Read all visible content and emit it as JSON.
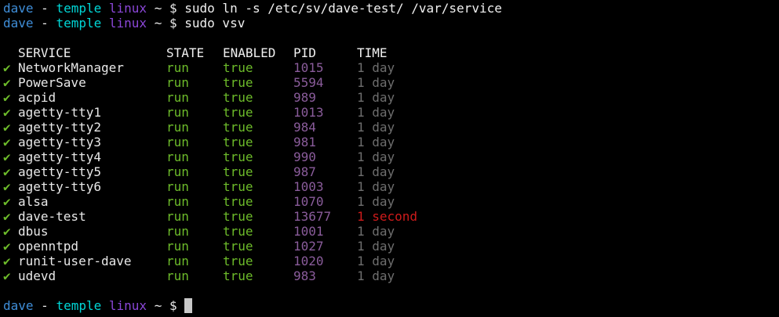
{
  "prompt": {
    "user": "dave",
    "dash": "-",
    "host": "temple",
    "os": "linux",
    "tilde": "~",
    "symbol": "$"
  },
  "commands": [
    "sudo ln -s /etc/sv/dave-test/ /var/service",
    "sudo vsv"
  ],
  "table": {
    "headers": {
      "service": "SERVICE",
      "state": "STATE",
      "enabled": "ENABLED",
      "pid": "PID",
      "time": "TIME"
    },
    "check_glyph": "✔",
    "rows": [
      {
        "service": "NetworkManager",
        "state": "run",
        "enabled": "true",
        "pid": "1015",
        "time": "1 day",
        "recent": false
      },
      {
        "service": "PowerSave",
        "state": "run",
        "enabled": "true",
        "pid": "5594",
        "time": "1 day",
        "recent": false
      },
      {
        "service": "acpid",
        "state": "run",
        "enabled": "true",
        "pid": "989",
        "time": "1 day",
        "recent": false
      },
      {
        "service": "agetty-tty1",
        "state": "run",
        "enabled": "true",
        "pid": "1013",
        "time": "1 day",
        "recent": false
      },
      {
        "service": "agetty-tty2",
        "state": "run",
        "enabled": "true",
        "pid": "984",
        "time": "1 day",
        "recent": false
      },
      {
        "service": "agetty-tty3",
        "state": "run",
        "enabled": "true",
        "pid": "981",
        "time": "1 day",
        "recent": false
      },
      {
        "service": "agetty-tty4",
        "state": "run",
        "enabled": "true",
        "pid": "990",
        "time": "1 day",
        "recent": false
      },
      {
        "service": "agetty-tty5",
        "state": "run",
        "enabled": "true",
        "pid": "987",
        "time": "1 day",
        "recent": false
      },
      {
        "service": "agetty-tty6",
        "state": "run",
        "enabled": "true",
        "pid": "1003",
        "time": "1 day",
        "recent": false
      },
      {
        "service": "alsa",
        "state": "run",
        "enabled": "true",
        "pid": "1070",
        "time": "1 day",
        "recent": false
      },
      {
        "service": "dave-test",
        "state": "run",
        "enabled": "true",
        "pid": "13677",
        "time": "1 second",
        "recent": true
      },
      {
        "service": "dbus",
        "state": "run",
        "enabled": "true",
        "pid": "1001",
        "time": "1 day",
        "recent": false
      },
      {
        "service": "openntpd",
        "state": "run",
        "enabled": "true",
        "pid": "1027",
        "time": "1 day",
        "recent": false
      },
      {
        "service": "runit-user-dave",
        "state": "run",
        "enabled": "true",
        "pid": "1020",
        "time": "1 day",
        "recent": false
      },
      {
        "service": "udevd",
        "state": "run",
        "enabled": "true",
        "pid": "983",
        "time": "1 day",
        "recent": false
      }
    ]
  },
  "colors": {
    "background": "#000000",
    "user": "#3f8ed8",
    "host": "#00d7d7",
    "os": "#8b47d8",
    "ok": "#6dbb2a",
    "pid": "#8a5c9b",
    "time_old": "#6e6e6e",
    "time_new": "#cf1b1b"
  }
}
